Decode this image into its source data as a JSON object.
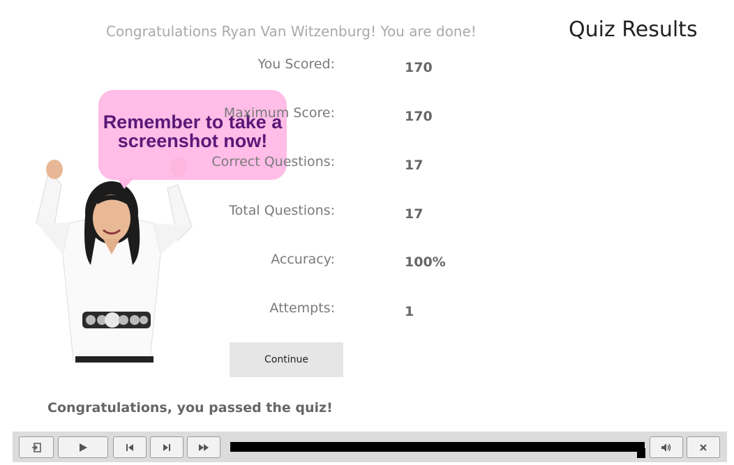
{
  "header": {
    "congrats": "Congratulations Ryan Van Witzenburg! You are done!",
    "title": "Quiz Results"
  },
  "results": [
    {
      "label": "You Scored:",
      "value": "170"
    },
    {
      "label": "Maximum Score:",
      "value": "170"
    },
    {
      "label": "Correct Questions:",
      "value": "17"
    },
    {
      "label": "Total Questions:",
      "value": "17"
    },
    {
      "label": "Accuracy:",
      "value": "100%"
    },
    {
      "label": "Attempts:",
      "value": "1"
    }
  ],
  "bubble": {
    "line1": "Remember to take a",
    "line2": "screenshot now!",
    "color": "#ffb7e5",
    "text_color": "#5a1877"
  },
  "continue_label": "Continue",
  "pass_message": "Congratulations, you passed the quiz!",
  "playbar": {
    "icons": [
      "exit-icon",
      "play-icon",
      "rewind-icon",
      "next-slide-icon",
      "fast-forward-icon",
      "audio-icon",
      "close-icon"
    ],
    "progress": 1.0
  }
}
